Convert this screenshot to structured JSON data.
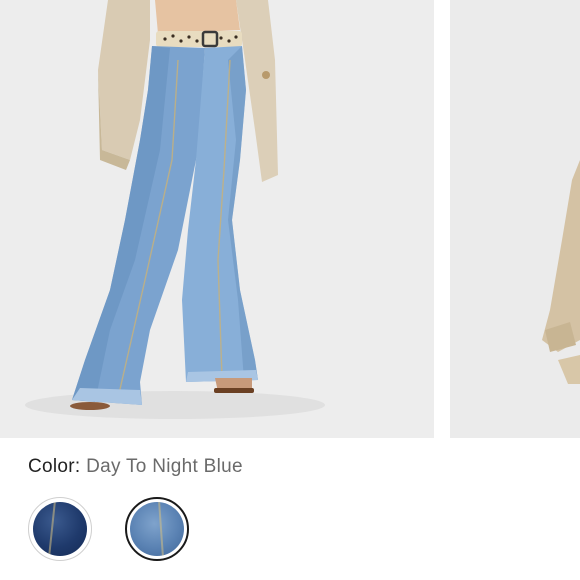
{
  "carousel": {
    "images": [
      {
        "icon": "model-wearing-flare-jeans-image"
      },
      {
        "icon": "model-side-view-partial-image"
      }
    ]
  },
  "color_selector": {
    "label": "Color:",
    "selected_value": "Day To Night Blue",
    "swatches": [
      {
        "name": "dark-wash-denim",
        "color": "#1f3a6c",
        "selected": false
      },
      {
        "name": "day-to-night-blue",
        "color": "#5a82b3",
        "selected": true
      }
    ]
  },
  "colors": {
    "background": "#ffffff",
    "image_bg": "#ededed",
    "text_primary": "#222222",
    "text_secondary": "#6a6a6a",
    "selected_border": "#1a1a1a",
    "unselected_border": "#cfcfcf"
  }
}
